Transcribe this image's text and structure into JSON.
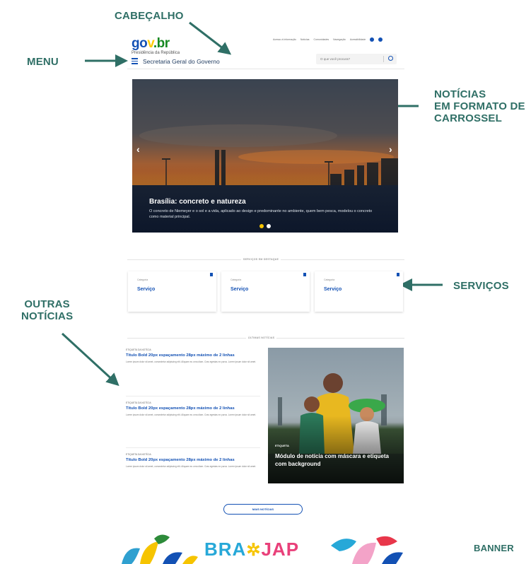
{
  "annotations": {
    "header": "CABEÇALHO",
    "menu": "MENU",
    "carousel_line1": "NOTÍCIAS",
    "carousel_line2": "EM FORMATO DE",
    "carousel_line3": "CARROSSEL",
    "services": "SERVIÇOS",
    "other_news_line1": "OUTRAS",
    "other_news_line2": "NOTÍCIAS",
    "banner": "BANNER"
  },
  "header": {
    "logo": {
      "part1": "go",
      "part2": "v",
      "part3": ".br"
    },
    "subtitle": "Presidência da República",
    "site_name": "Secretaria Geral do Governo",
    "util_links": [
      "Acesso à Informação",
      "Notícias",
      "Comunidades",
      "Navegação",
      "Acessibilidade"
    ],
    "search_placeholder": "O que você procura?"
  },
  "carousel": {
    "title": "Brasília: concreto e natureza",
    "description": "O concreto de Niemeyer e o sol e a vida, aplicado ao design e predominante no ambiente, quem bem pesca, modelou o concreto como material principal.",
    "prev_icon": "chevron-left-icon",
    "next_icon": "chevron-right-icon",
    "active_slide": 1,
    "dot_colors": [
      "#f6c400",
      "#ffffff"
    ]
  },
  "services": {
    "section_label": "SERVIÇOS EM DESTAQUE",
    "cards": [
      {
        "category": "Categoria",
        "name": "Serviço"
      },
      {
        "category": "Categoria",
        "name": "Serviço"
      },
      {
        "category": "Categoria",
        "name": "Serviço"
      }
    ]
  },
  "news": {
    "section_label": "ÚLTIMAS NOTÍCIAS",
    "items": [
      {
        "tag": "ETIQUETA DA NOTÍCIA",
        "title": "Título Bold 20px espaçamento 28px máximo de 2 linhas",
        "body": "Lorem ipsum dolor sit amet, consectetur adipiscing elit. Aliquam eu urna diam. Cras egestas ex purus. Lorem ipsum dolor sit amet."
      },
      {
        "tag": "ETIQUETA DA NOTÍCIA",
        "title": "Título Bold 20px espaçamento 28px máximo de 2 linhas",
        "body": "Lorem ipsum dolor sit amet, consectetur adipiscing elit. Aliquam eu urna diam. Cras egestas ex purus. Lorem ipsum dolor sit amet."
      },
      {
        "tag": "ETIQUETA DA NOTÍCIA",
        "title": "Título Bold 20px espaçamento 28px máximo de 2 linhas",
        "body": "Lorem ipsum dolor sit amet, consectetur adipiscing elit. Aliquam eu urna diam. Cras egestas ex purus. Lorem ipsum dolor sit amet."
      }
    ],
    "feature": {
      "tag": "ETIQUETA",
      "title": "Módulo de notícia com máscara e etiqueta com background"
    },
    "more_button": "MAIS NOTÍCIAS"
  },
  "banner": {
    "left": "BRA",
    "star": "✲",
    "right": "JAP"
  },
  "colors": {
    "annotation": "#2f6f66",
    "primary": "#1351b4",
    "banner_blue": "#27a8d8",
    "banner_pink": "#e9407a",
    "banner_yellow": "#f6c400"
  }
}
